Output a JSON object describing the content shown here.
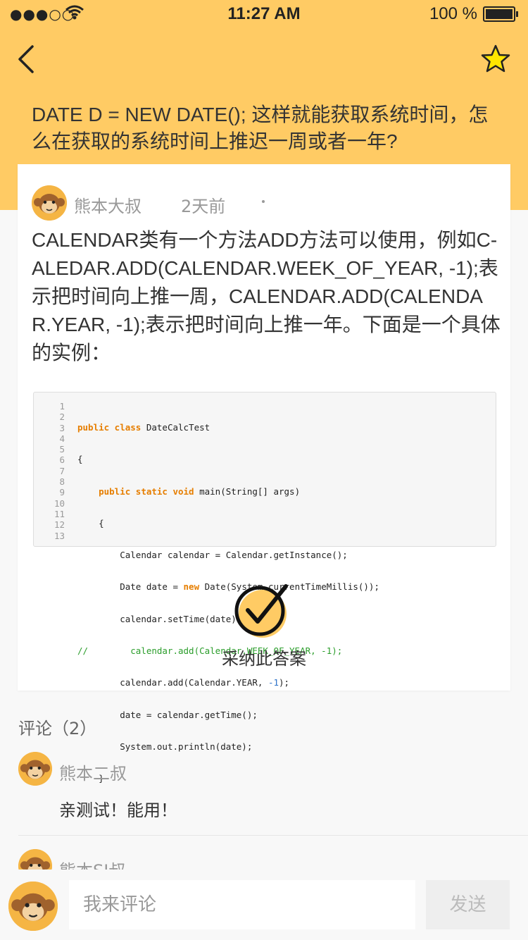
{
  "status_bar": {
    "signal": "●●●○○",
    "time": "11:27 AM",
    "battery": "100 %"
  },
  "header": {
    "question": "DATE D = NEW DATE(); 这样就能获取系统时间，怎么在获取的系统时间上推迟一周或者一年?"
  },
  "answer": {
    "author": "熊本大叔",
    "time_ago": "2天前",
    "text": "CALENDAR类有一个方法ADD方法可以使用，例如C-ALEDAR.ADD(CALENDAR.WEEK_OF_YEAR, -1);表示把时间向上推一周，CALENDAR.ADD(CALENDAR.YEAR, -1);表示把时间向上推一年。下面是一个具体的实例：",
    "code_line_numbers": [
      "1",
      "2",
      "3",
      "4",
      "5",
      "6",
      "7",
      "8",
      "9",
      "10",
      "11",
      "12",
      "13"
    ],
    "code": {
      "l1_kw": "public class",
      "l1": " DateCalcTest",
      "l2": "{",
      "l3_kw": "public static void",
      "l3": " main(String[] args)",
      "l4": "{",
      "l5": "Calendar calendar = Calendar.getInstance();",
      "l6_a": "Date date = ",
      "l6_kw": "new",
      "l6_b": " Date(System.currentTimeMillis());",
      "l7": "calendar.setTime(date);",
      "l8_cm": "//        calendar.add(Calendar.WEEK_OF_YEAR, -1);",
      "l9_a": "calendar.add(Calendar.YEAR, ",
      "l9_num": "-1",
      "l9_b": ");",
      "l10": "date = calendar.getTime();",
      "l11": "System.out.println(date);",
      "l12": "}",
      "l13": "}"
    },
    "accept_label": "采纳此答案"
  },
  "comments": {
    "title": "评论（2）",
    "items": [
      {
        "author": "熊本二叔",
        "text": "亲测试！能用！"
      },
      {
        "author": "熊本SI叔"
      }
    ]
  },
  "bottom_bar": {
    "input_placeholder": "我来评论",
    "send_label": "发送"
  },
  "colors": {
    "header_bg": "#ffcb64",
    "page_bg": "#f8f8f8",
    "text": "#333333",
    "muted": "#999999",
    "secondary": "#666666"
  },
  "icons": [
    "back-icon",
    "star-icon",
    "accept-check-icon",
    "monkey-avatar-icon"
  ]
}
